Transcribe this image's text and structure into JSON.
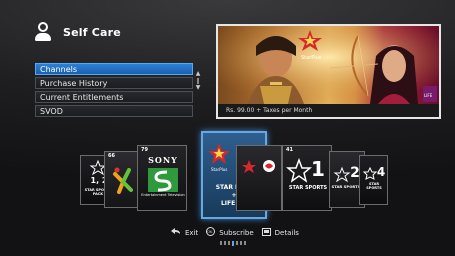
{
  "header": {
    "title": "Self Care",
    "icon": "user-icon"
  },
  "menu": {
    "items": [
      {
        "label": "Channels",
        "active": true
      },
      {
        "label": "Purchase History",
        "active": false
      },
      {
        "label": "Current Entitlements",
        "active": false
      },
      {
        "label": "SVOD",
        "active": false
      }
    ]
  },
  "banner": {
    "price": "Rs. 99.00 + Taxes per Month",
    "logo_text": "StarPlus"
  },
  "carousel": {
    "tiles": [
      {
        "number": "",
        "caption_top": "1, 2",
        "caption_bottom": "STAR SPORTS PACK",
        "name": "star-sports-pack"
      },
      {
        "number": "66",
        "name": "kids-channel"
      },
      {
        "number": "79",
        "logo_text": "SONY",
        "sub_text": "Entertainment Television",
        "name": "sony"
      },
      {
        "number": "",
        "name": "star-plus-life-ok",
        "logos": [
          "StarPlus",
          "LifeOK"
        ],
        "caption": [
          "STAR PLUS",
          "+",
          "LIFE OK"
        ]
      },
      {
        "number": "",
        "name": "star-plus-life-ok-preview"
      },
      {
        "number": "41",
        "logo_text": "1",
        "caption": "STAR SPORTS",
        "name": "star-sports-1"
      },
      {
        "number": "",
        "logo_text": "2",
        "caption": "STAR SPORTS",
        "name": "star-sports-2"
      },
      {
        "number": "",
        "logo_text": "4",
        "caption": "STAR SPORTS",
        "name": "star-sports-4"
      }
    ]
  },
  "footer": {
    "exit": "Exit",
    "subscribe": "Subscribe",
    "details": "Details"
  },
  "colors": {
    "accent": "#2b80d8",
    "star_red": "#d7262c",
    "sony_green": "#2f9a3c"
  }
}
